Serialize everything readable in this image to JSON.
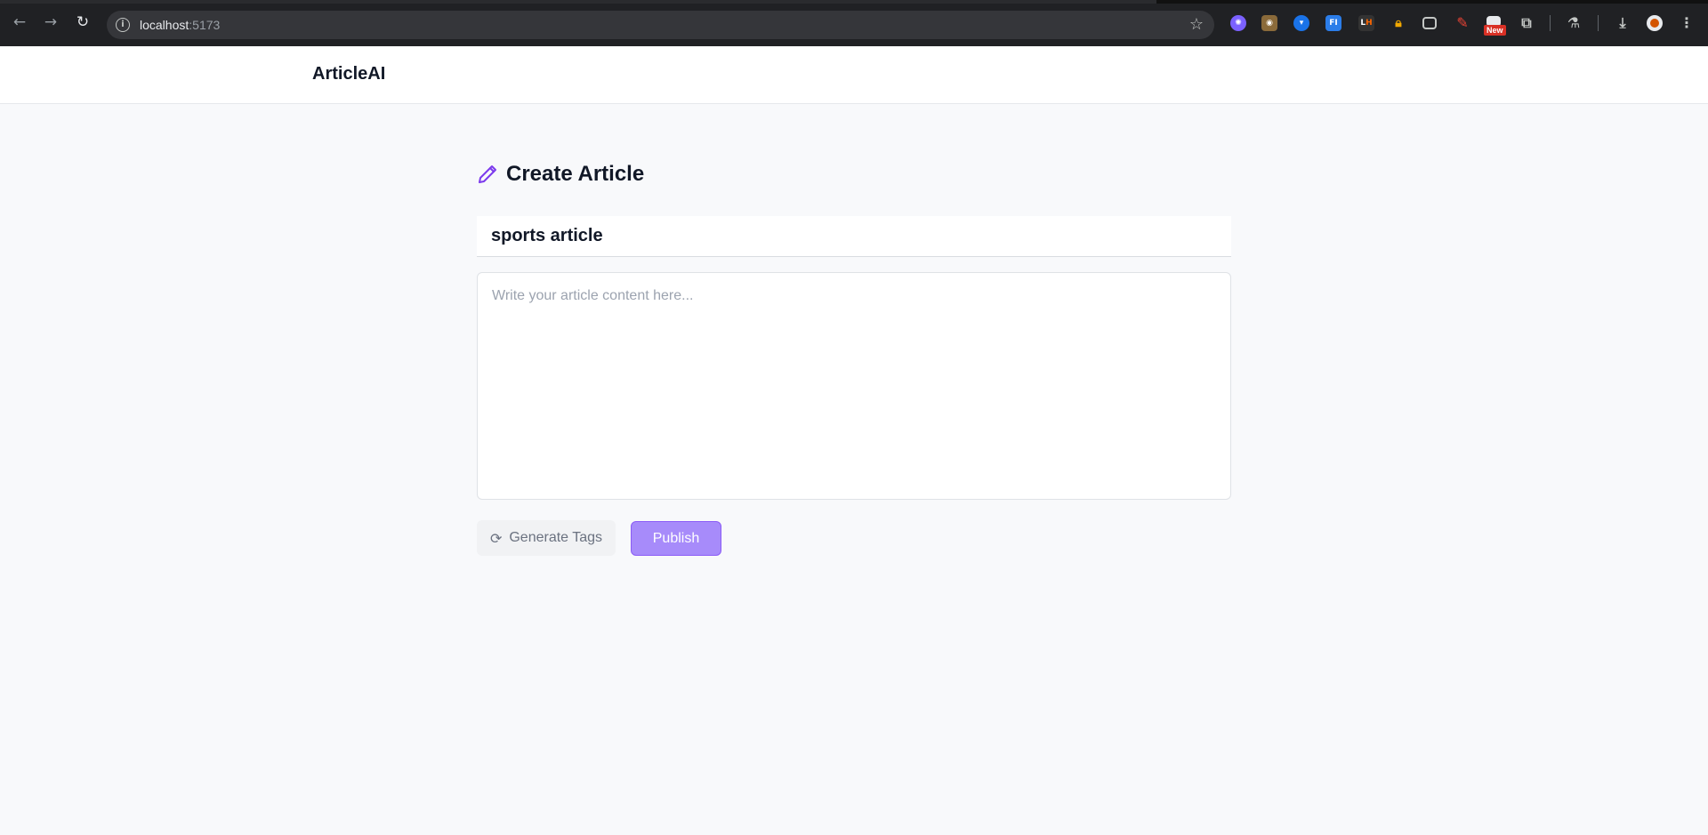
{
  "browser": {
    "url_host": "localhost",
    "url_port": ":5173",
    "new_badge": "New",
    "extensions": [
      {
        "icon": "puzzle-purple-icon",
        "color": "#7b61ff"
      },
      {
        "icon": "owl-icon",
        "color": "#8a6a3a"
      },
      {
        "icon": "shield-v-icon",
        "color": "#1a73e8"
      },
      {
        "icon": "fi-icon",
        "color": "#2b7de9",
        "text": "FI"
      },
      {
        "icon": "lh-icon",
        "color": "#333",
        "text": "LH"
      },
      {
        "icon": "lock-icon",
        "color": "#f2a900"
      },
      {
        "icon": "window-icon",
        "color": "#5f6368"
      },
      {
        "icon": "pen-red-icon",
        "color": "#ea4335"
      },
      {
        "icon": "calendar-new-icon",
        "color": "#e8eaed"
      }
    ]
  },
  "header": {
    "brand": "ArticleAI"
  },
  "main": {
    "page_title": "Create Article",
    "title_value": "sports article",
    "content_placeholder": "Write your article content here...",
    "generate_tags_label": "Generate Tags",
    "publish_label": "Publish"
  },
  "colors": {
    "accent": "#7c3aed",
    "publish_bg": "#a78bfa",
    "page_bg": "#f8f9fb"
  }
}
